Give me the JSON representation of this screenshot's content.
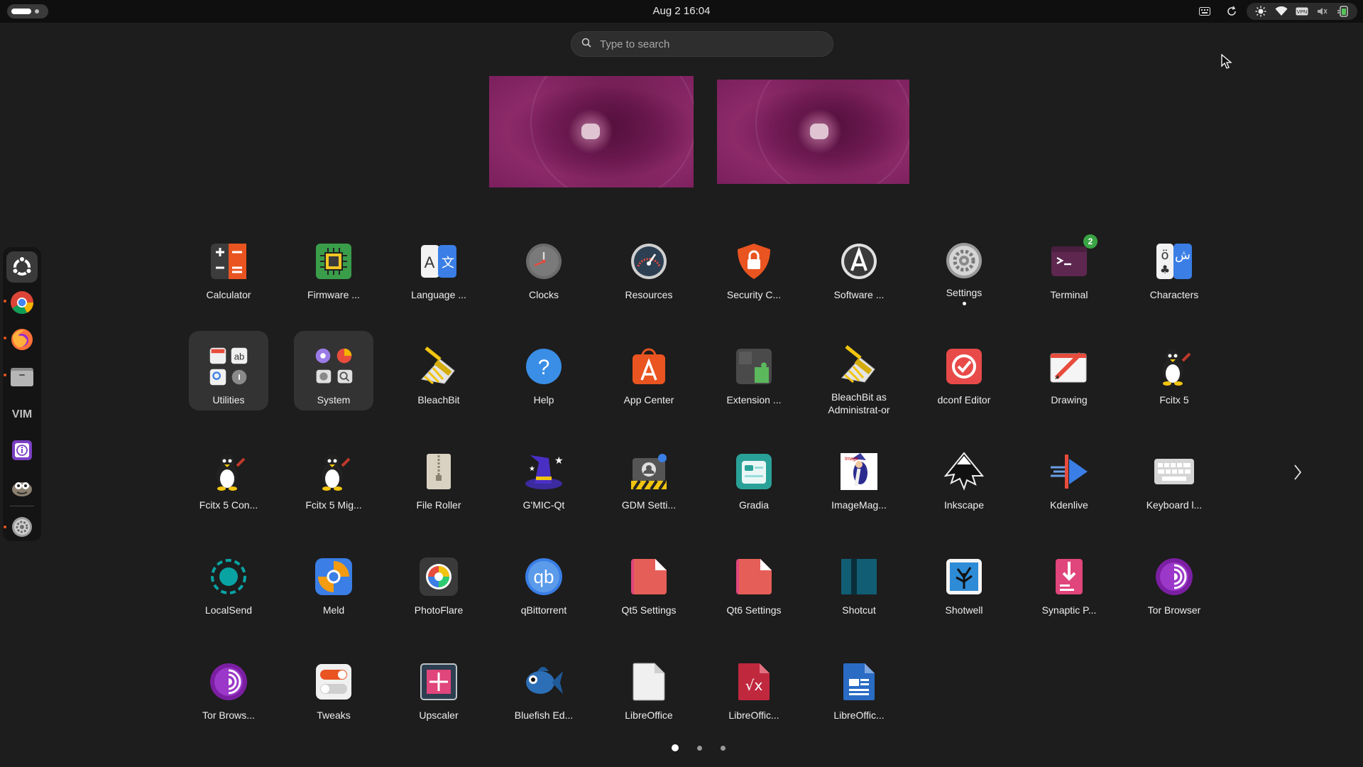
{
  "topbar": {
    "clock": "Aug 2  16:04",
    "tray_icons": [
      "keyboard-icon",
      "refresh-icon",
      "brightness-icon",
      "wifi-icon",
      "vpn-icon",
      "volume-icon",
      "battery-icon"
    ]
  },
  "search": {
    "placeholder": "Type to search",
    "value": ""
  },
  "workspaces": [
    {
      "name": "workspace-1"
    },
    {
      "name": "workspace-2"
    }
  ],
  "dock": {
    "items": [
      {
        "name": "ubuntu-logo-icon",
        "active": true
      },
      {
        "name": "chrome-icon",
        "running": true
      },
      {
        "name": "firefox-icon",
        "running": true
      },
      {
        "name": "files-icon",
        "running": true
      },
      {
        "name": "vim-icon"
      },
      {
        "name": "info-icon"
      },
      {
        "name": "gimp-icon"
      },
      {
        "name": "settings-icon",
        "running": true
      }
    ]
  },
  "apps": [
    {
      "label": "Calculator",
      "icon": "calculator-icon"
    },
    {
      "label": "Firmware ...",
      "icon": "chip-icon"
    },
    {
      "label": "Language ...",
      "icon": "language-icon"
    },
    {
      "label": "Clocks",
      "icon": "clock-icon"
    },
    {
      "label": "Resources",
      "icon": "gauge-icon"
    },
    {
      "label": "Security C...",
      "icon": "shield-lock-icon"
    },
    {
      "label": "Software ...",
      "icon": "software-updater-icon"
    },
    {
      "label": "Settings",
      "icon": "gear-icon",
      "running": true
    },
    {
      "label": "Terminal",
      "icon": "terminal-icon",
      "badge": "2"
    },
    {
      "label": "Characters",
      "icon": "characters-icon"
    },
    {
      "label": "Utilities",
      "icon": "folder-utilities-icon",
      "folder": true
    },
    {
      "label": "System",
      "icon": "folder-system-icon",
      "folder": true
    },
    {
      "label": "BleachBit",
      "icon": "broom-icon"
    },
    {
      "label": "Help",
      "icon": "help-icon"
    },
    {
      "label": "App Center",
      "icon": "app-center-icon"
    },
    {
      "label": "Extension ...",
      "icon": "puzzle-icon"
    },
    {
      "label": "BleachBit as Administrat-or",
      "icon": "broom-admin-icon"
    },
    {
      "label": "dconf Editor",
      "icon": "dconf-icon"
    },
    {
      "label": "Drawing",
      "icon": "drawing-icon"
    },
    {
      "label": "Fcitx 5",
      "icon": "penguin-icon"
    },
    {
      "label": "Fcitx 5 Con...",
      "icon": "penguin-icon"
    },
    {
      "label": "Fcitx 5 Mig...",
      "icon": "penguin-icon"
    },
    {
      "label": "File Roller",
      "icon": "archive-icon"
    },
    {
      "label": "G'MIC-Qt",
      "icon": "wizard-hat-icon"
    },
    {
      "label": "GDM Setti...",
      "icon": "gdm-icon"
    },
    {
      "label": "Gradia",
      "icon": "gradia-icon"
    },
    {
      "label": "ImageMag...",
      "icon": "imagemagick-icon"
    },
    {
      "label": "Inkscape",
      "icon": "inkscape-icon"
    },
    {
      "label": "Kdenlive",
      "icon": "kdenlive-icon"
    },
    {
      "label": "Keyboard l...",
      "icon": "keyboard-icon"
    },
    {
      "label": "LocalSend",
      "icon": "localsend-icon"
    },
    {
      "label": "Meld",
      "icon": "meld-icon"
    },
    {
      "label": "PhotoFlare",
      "icon": "photoflare-icon"
    },
    {
      "label": "qBittorrent",
      "icon": "qbittorrent-icon"
    },
    {
      "label": "Qt5 Settings",
      "icon": "qt-settings-icon"
    },
    {
      "label": "Qt6 Settings",
      "icon": "qt-settings-icon"
    },
    {
      "label": "Shotcut",
      "icon": "shotcut-icon"
    },
    {
      "label": "Shotwell",
      "icon": "shotwell-icon"
    },
    {
      "label": "Synaptic P...",
      "icon": "synaptic-icon"
    },
    {
      "label": "Tor Browser",
      "icon": "tor-icon"
    },
    {
      "label": "Tor Brows...",
      "icon": "tor-icon"
    },
    {
      "label": "Tweaks",
      "icon": "toggle-icon"
    },
    {
      "label": "Upscaler",
      "icon": "upscaler-icon"
    },
    {
      "label": "Bluefish Ed...",
      "icon": "fish-icon"
    },
    {
      "label": "LibreOffice",
      "icon": "document-icon"
    },
    {
      "label": "LibreOffic...",
      "icon": "libreoffice-math-icon"
    },
    {
      "label": "LibreOffic...",
      "icon": "libreoffice-writer-icon"
    }
  ],
  "pager": {
    "pages": 3,
    "current": 1
  },
  "colors": {
    "background": "#1d1d1d",
    "accent": "#e95420",
    "topbar": "#0f0f0f"
  }
}
